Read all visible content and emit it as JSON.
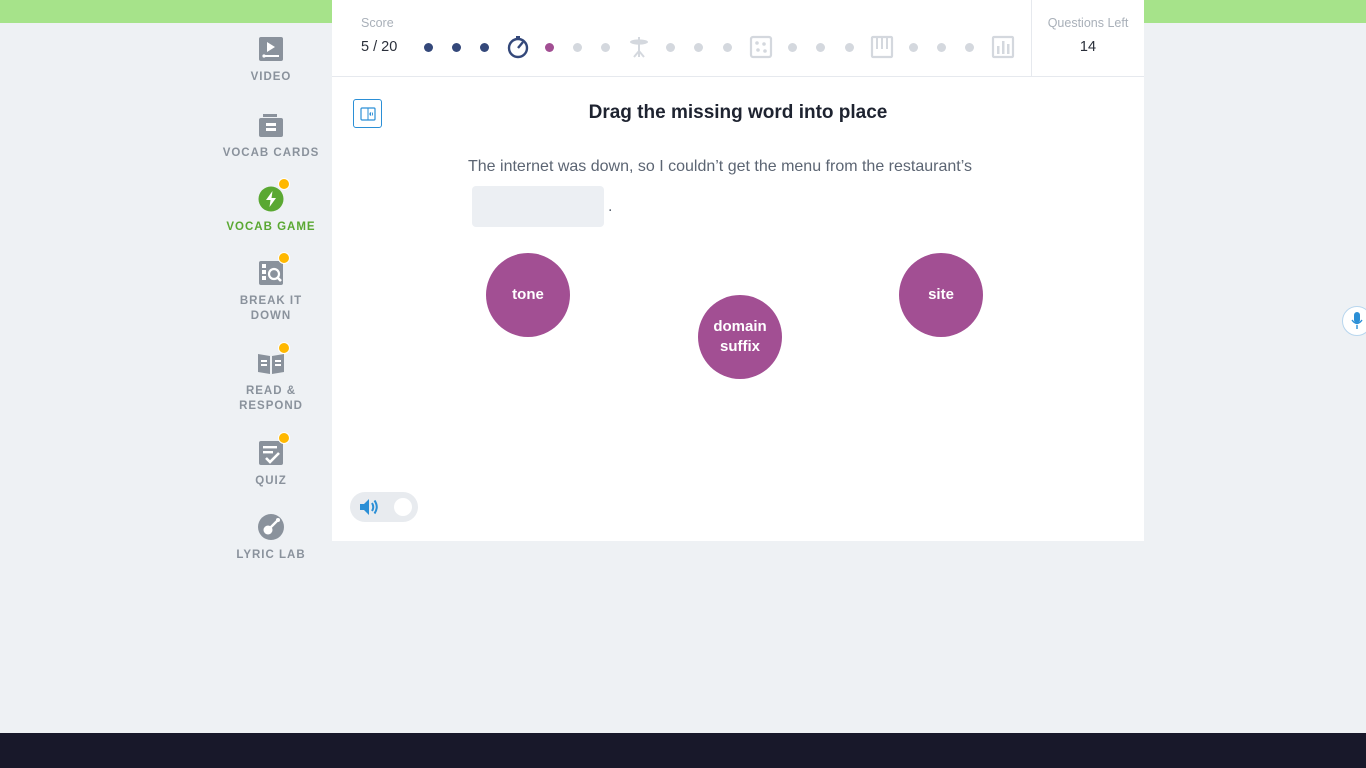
{
  "sidebar": {
    "items": [
      {
        "label": "VIDEO",
        "icon": "video-icon",
        "badge": false
      },
      {
        "label": "VOCAB CARDS",
        "icon": "vocab-cards-icon",
        "badge": false
      },
      {
        "label": "VOCAB GAME",
        "icon": "lightning-icon",
        "badge": true,
        "active": true
      },
      {
        "label": "BREAK IT DOWN",
        "icon": "magnify-grid-icon",
        "badge": true
      },
      {
        "label": "READ & RESPOND",
        "icon": "book-icon",
        "badge": true
      },
      {
        "label": "QUIZ",
        "icon": "checklist-icon",
        "badge": true
      },
      {
        "label": "LYRIC LAB",
        "icon": "guitar-icon",
        "badge": false
      }
    ]
  },
  "header": {
    "score_label": "Score",
    "score_value": "5 / 20",
    "questions_left_label": "Questions Left",
    "questions_left_value": "14"
  },
  "progress": {
    "completed": 5,
    "total": 20,
    "current_index": 4,
    "milestone_icons": [
      "stopwatch-icon",
      "cymbal-icon",
      "bingo-card-icon",
      "piano-icon",
      "chart-icon"
    ]
  },
  "question": {
    "title": "Drag the missing word into place",
    "sentence": "The internet was down, so I couldn’t get the menu from the restaurant’s",
    "period": "."
  },
  "options": [
    {
      "label": "tone"
    },
    {
      "label": "domain suffix"
    },
    {
      "label": "site"
    }
  ],
  "colors": {
    "accent_green": "#5aa832",
    "option_purple": "#a24f93",
    "progress_done": "#34487a",
    "top_strip": "#a6e38a",
    "bottom_bar": "#18182a",
    "badge": "#ffb800"
  }
}
